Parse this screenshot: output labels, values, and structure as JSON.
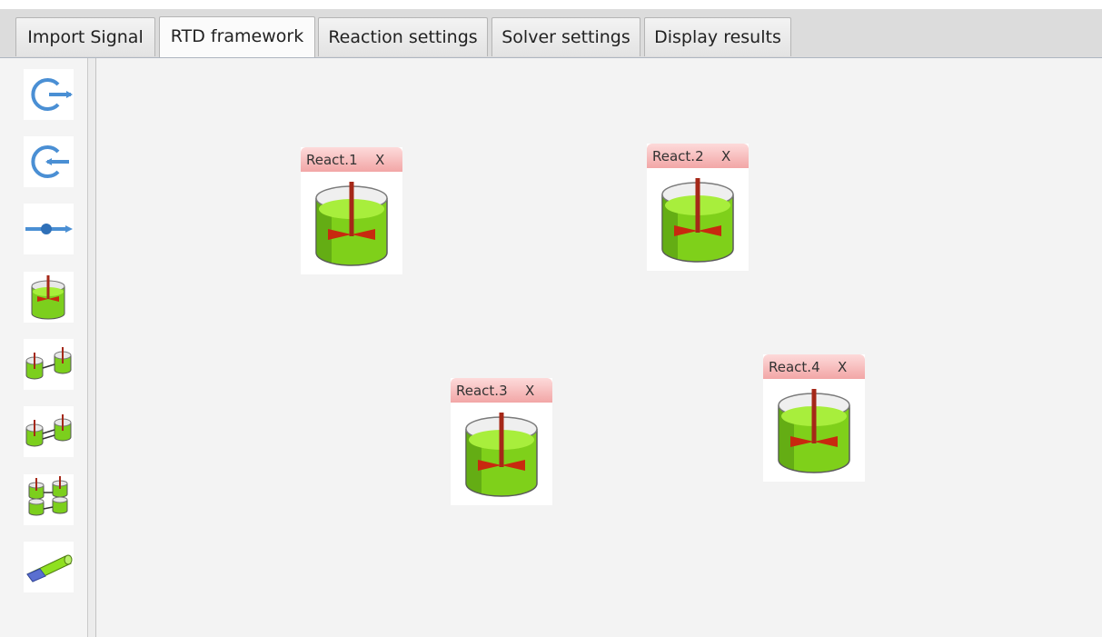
{
  "tabs": [
    "Import Signal",
    "RTD framework",
    "Reaction settings",
    "Solver settings",
    "Display results"
  ],
  "active_tab": "RTD framework",
  "toolbox": [
    {
      "icon": "signal-input-icon"
    },
    {
      "icon": "signal-output-icon"
    },
    {
      "icon": "flow-connector-icon"
    },
    {
      "icon": "single-reactor-icon"
    },
    {
      "icon": "reactors-in-series-icon"
    },
    {
      "icon": "reactors-with-exchange-icon"
    },
    {
      "icon": "reactor-network-icon"
    },
    {
      "icon": "plug-flow-reactor-icon"
    }
  ],
  "reactors": [
    {
      "label": "React.1",
      "close": "X"
    },
    {
      "label": "React.2",
      "close": "X"
    },
    {
      "label": "React.3",
      "close": "X"
    },
    {
      "label": "React.4",
      "close": "X"
    }
  ],
  "colors": {
    "liquid": "#8fe01f",
    "impeller": "#c8290f",
    "shaft": "#a52818",
    "tool_icon": "#4a8fd4",
    "header": "#f5b3b3"
  }
}
